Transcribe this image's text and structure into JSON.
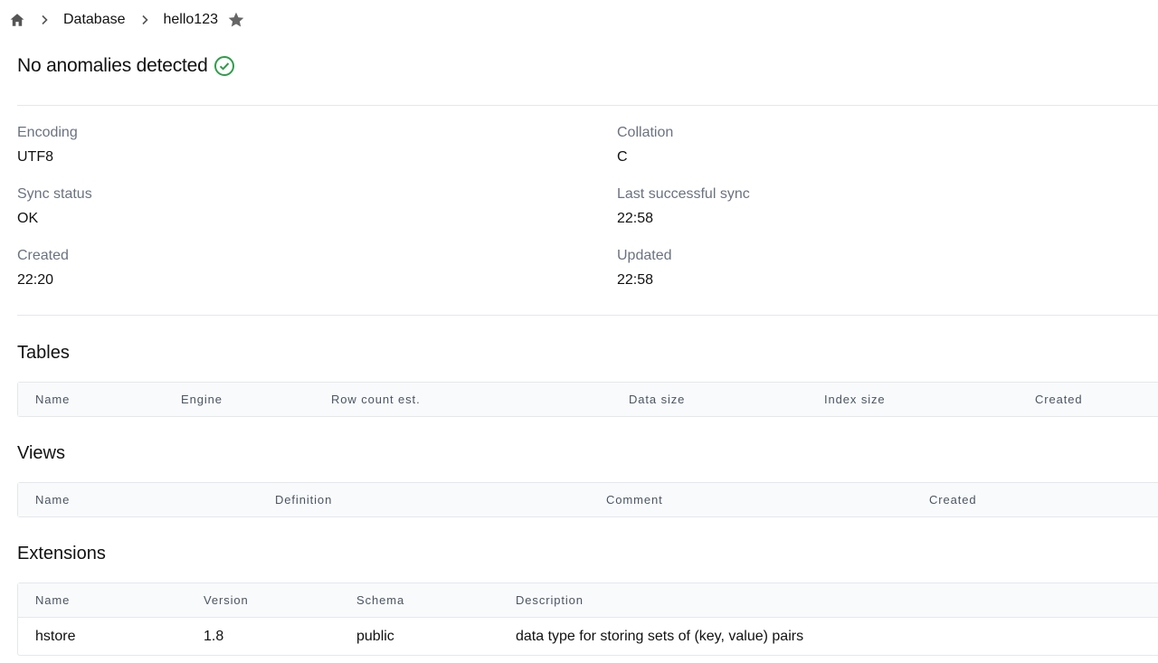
{
  "breadcrumb": {
    "home_icon": "home-icon",
    "items": [
      "Database",
      "hello123"
    ],
    "star_icon": "star-icon"
  },
  "header": {
    "title": "No anomalies detected",
    "status_icon": "check-circle-icon",
    "status_color": "#2e9e4a"
  },
  "info": {
    "left": [
      {
        "label": "Encoding",
        "value": "UTF8"
      },
      {
        "label": "Sync status",
        "value": "OK"
      },
      {
        "label": "Created",
        "value": "22:20"
      }
    ],
    "right": [
      {
        "label": "Collation",
        "value": "C"
      },
      {
        "label": "Last successful sync",
        "value": "22:58"
      },
      {
        "label": "Updated",
        "value": "22:58"
      }
    ]
  },
  "tables": {
    "title": "Tables",
    "columns": [
      "Name",
      "Engine",
      "Row count est.",
      "Data size",
      "Index size",
      "Created"
    ]
  },
  "views": {
    "title": "Views",
    "columns": [
      "Name",
      "Definition",
      "Comment",
      "Created"
    ]
  },
  "extensions": {
    "title": "Extensions",
    "columns": [
      "Name",
      "Version",
      "Schema",
      "Description"
    ],
    "rows": [
      {
        "name": "hstore",
        "version": "1.8",
        "schema": "public",
        "description": "data type for storing sets of (key, value) pairs"
      }
    ]
  }
}
